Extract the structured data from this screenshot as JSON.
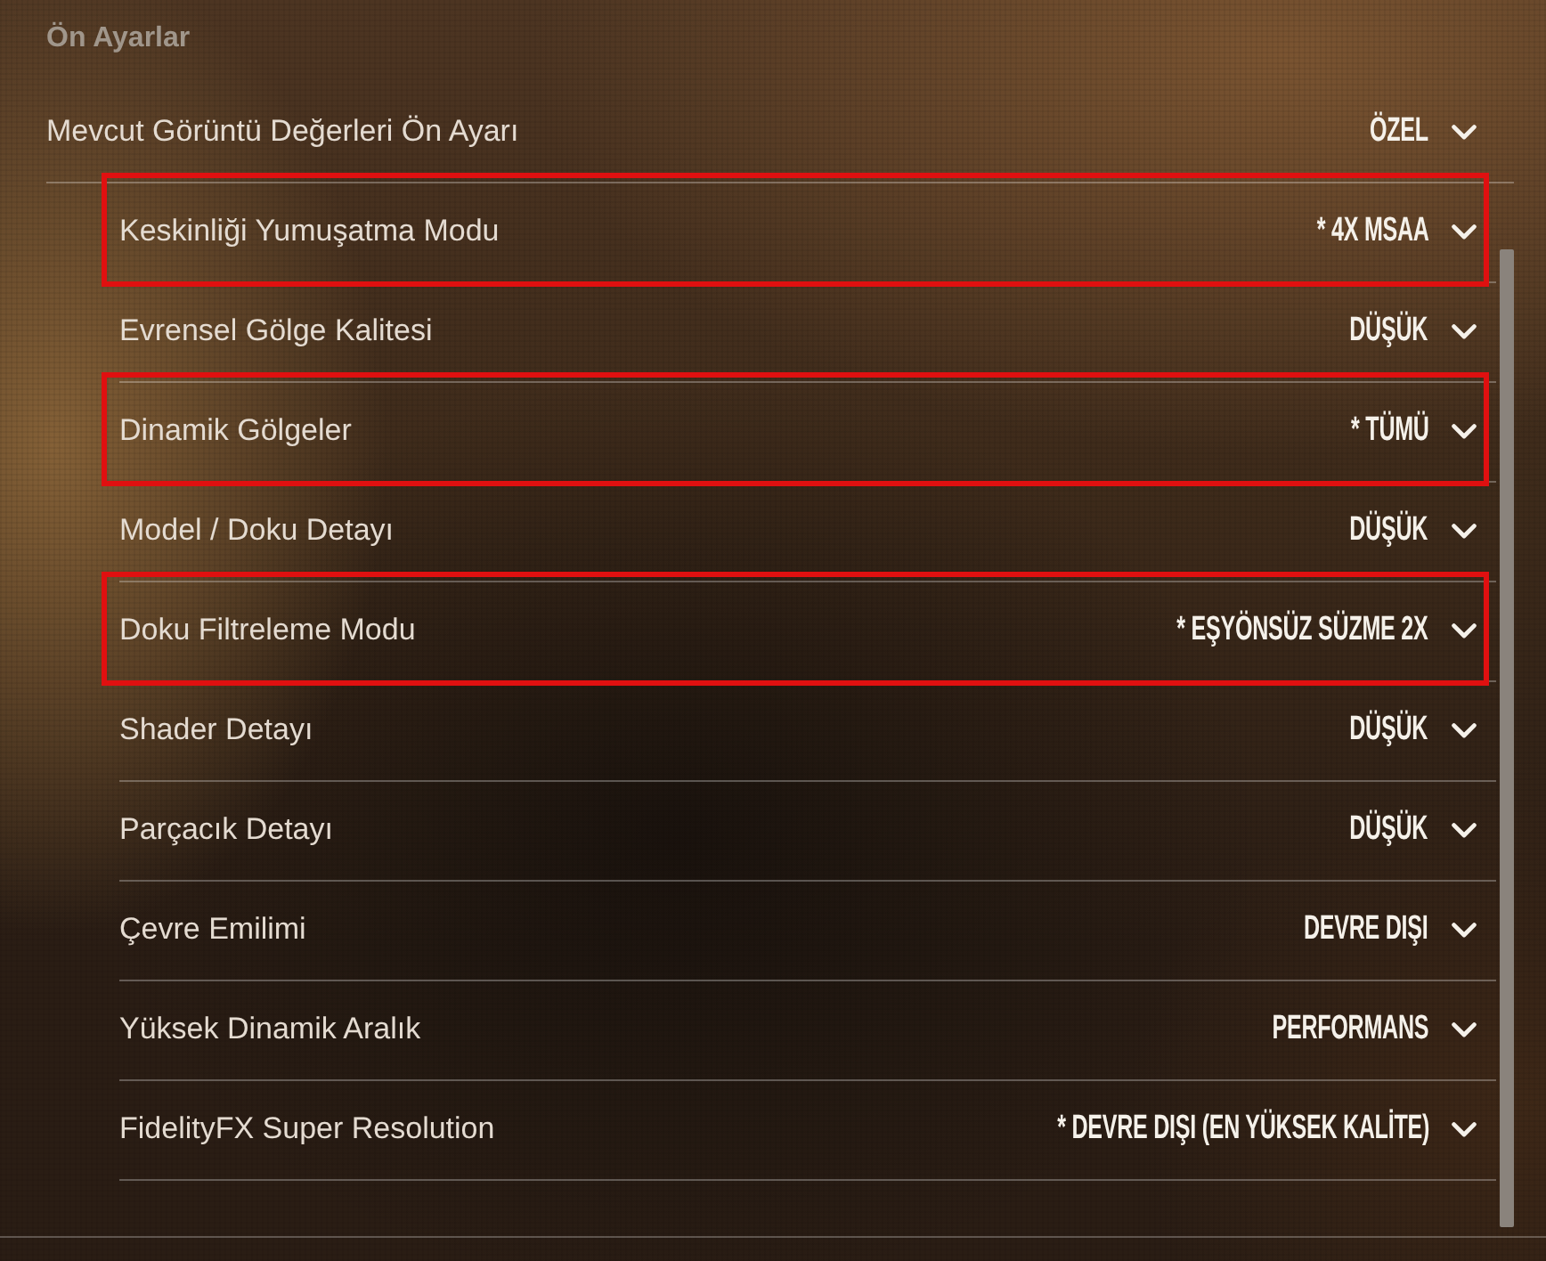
{
  "section": {
    "title": "Ön Ayarlar"
  },
  "preset": {
    "label": "Mevcut Görüntü Değerleri Ön Ayarı",
    "value": "ÖZEL"
  },
  "settings": [
    {
      "label": "Keskinliği Yumuşatma Modu",
      "value": "* 4X MSAA",
      "highlighted": true
    },
    {
      "label": "Evrensel Gölge Kalitesi",
      "value": "DÜŞÜK",
      "highlighted": false
    },
    {
      "label": "Dinamik Gölgeler",
      "value": "* TÜMÜ",
      "highlighted": true
    },
    {
      "label": "Model / Doku Detayı",
      "value": "DÜŞÜK",
      "highlighted": false
    },
    {
      "label": "Doku Filtreleme Modu",
      "value": "* EŞYÖNSÜZ SÜZME 2X",
      "highlighted": true
    },
    {
      "label": "Shader Detayı",
      "value": "DÜŞÜK",
      "highlighted": false
    },
    {
      "label": "Parçacık Detayı",
      "value": "DÜŞÜK",
      "highlighted": false
    },
    {
      "label": "Çevre Emilimi",
      "value": "DEVRE DIŞI",
      "highlighted": false
    },
    {
      "label": "Yüksek Dinamik Aralık",
      "value": "PERFORMANS",
      "highlighted": false
    },
    {
      "label": "FidelityFX Super Resolution",
      "value": "* DEVRE DIŞI (EN YÜKSEK KALİTE)",
      "highlighted": false
    }
  ]
}
